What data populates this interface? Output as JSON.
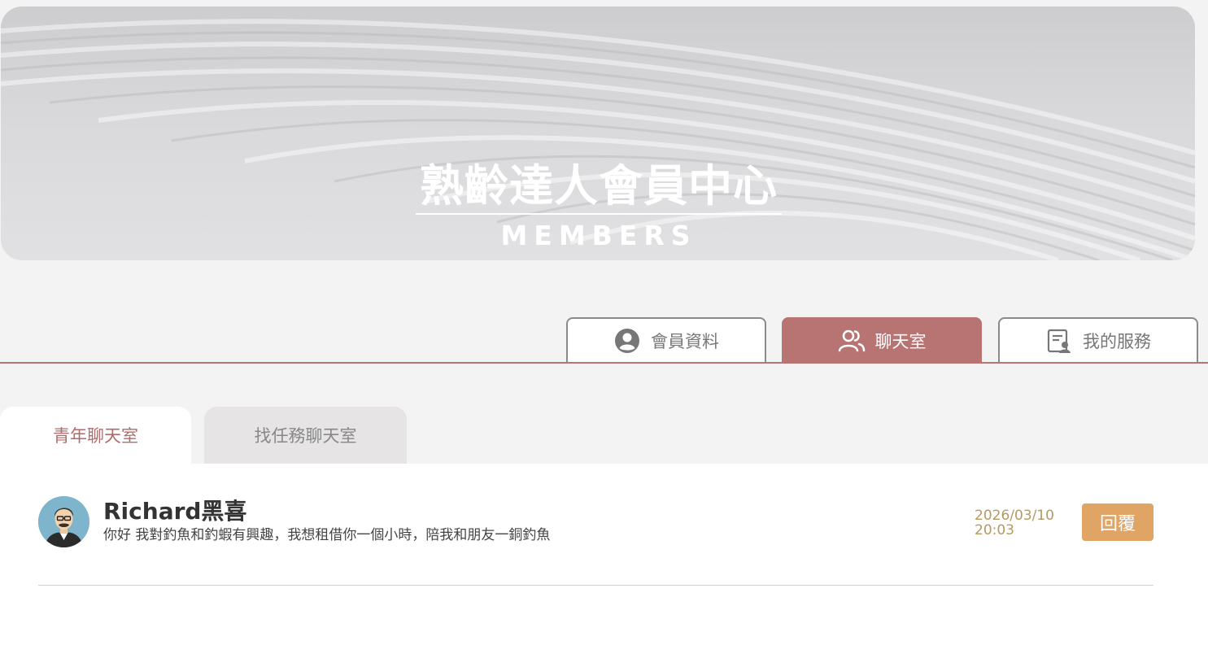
{
  "banner": {
    "title": "熟齡達人會員中心",
    "subtitle": "MEMBERS"
  },
  "main_tabs": [
    {
      "label": "會員資料",
      "icon": "user-circle-icon",
      "active": false
    },
    {
      "label": "聊天室",
      "icon": "users-icon",
      "active": true
    },
    {
      "label": "我的服務",
      "icon": "service-list-icon",
      "active": false
    }
  ],
  "sub_tabs": [
    {
      "label": "青年聊天室",
      "active": true
    },
    {
      "label": "找任務聊天室",
      "active": false
    }
  ],
  "messages": [
    {
      "avatar_icon": "user-avatar-icon",
      "sender": "Richard黑喜",
      "text": "你好 我對釣魚和釣蝦有興趣，我想租借你一個小時，陪我和朋友一銅釣魚",
      "date": "2026/03/10",
      "time": "20:03",
      "reply_label": "回覆"
    }
  ],
  "colors": {
    "accent": "#b87373",
    "reply_button": "#e0a465",
    "timestamp": "#b59a5f",
    "background": "#f3f3f3"
  }
}
